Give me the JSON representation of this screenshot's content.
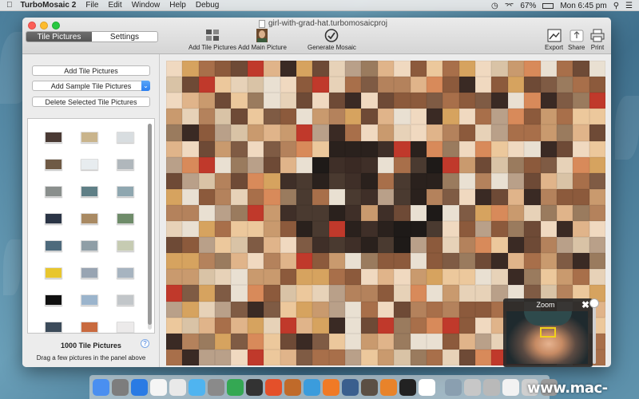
{
  "menubar": {
    "app_name": "TurboMosaic 2",
    "menus": [
      "File",
      "Edit",
      "Window",
      "Help",
      "Debug"
    ],
    "battery": "67%",
    "clock": "Mon 6:45 pm"
  },
  "window": {
    "document_title": "girl-with-grad-hat.turbomosaicproj",
    "tabs": [
      {
        "label": "Tile Pictures",
        "active": true
      },
      {
        "label": "Settings",
        "active": false
      }
    ],
    "toolbar": {
      "add_tile_pictures": "Add Tile Pictures",
      "add_main_picture": "Add Main Picture",
      "generate_mosaic": "Generate Mosaic",
      "export": "Export",
      "share": "Share",
      "print": "Print"
    }
  },
  "sidebar": {
    "add_tile_pictures": "Add Tile Pictures",
    "add_sample_tile_pictures": "Add Sample Tile Pictures",
    "delete_selected": "Delete Selected Tile Pictures",
    "tile_count": "1000 Tile Pictures",
    "help": "?",
    "hint": "Drag a few pictures in the panel above",
    "thumbnails": [
      "#4a3a34",
      "#c9b48c",
      "#d8dde0",
      "#6f5a45",
      "#e7ecef",
      "#b0b7bc",
      "#8a8f8d",
      "#5f7f86",
      "#8fa7b0",
      "#2b3546",
      "#a98a63",
      "#6f8c6a",
      "#4e6a7c",
      "#8f9ea6",
      "#c6cbb2",
      "#e8c62e",
      "#98a4b2",
      "#a7b4c0",
      "#101010",
      "#9bb4cc",
      "#c2c6c9",
      "#3c4b5a",
      "#c86a3f",
      "#eceaea"
    ]
  },
  "zoom": {
    "label": "Zoom",
    "close": "✖"
  },
  "dock": {
    "icon_colors": [
      "#4a8ff0",
      "#7d7d7d",
      "#2a7be4",
      "#f5f5f5",
      "#e9e9e9",
      "#4fb4f0",
      "#8a8a8a",
      "#34a853",
      "#333333",
      "#e4502a",
      "#c06a2a",
      "#3b9cdc",
      "#f07a26",
      "#3a5f8e",
      "#5b4f44",
      "#e8832a",
      "#222222",
      "#ffffff",
      "#8a9fb0",
      "#c7c7c7",
      "#b9b9b9",
      "#f2f2f2",
      "#cfcfcf",
      "#9a9a9a"
    ]
  },
  "watermark": "www.mac-gm.com"
}
